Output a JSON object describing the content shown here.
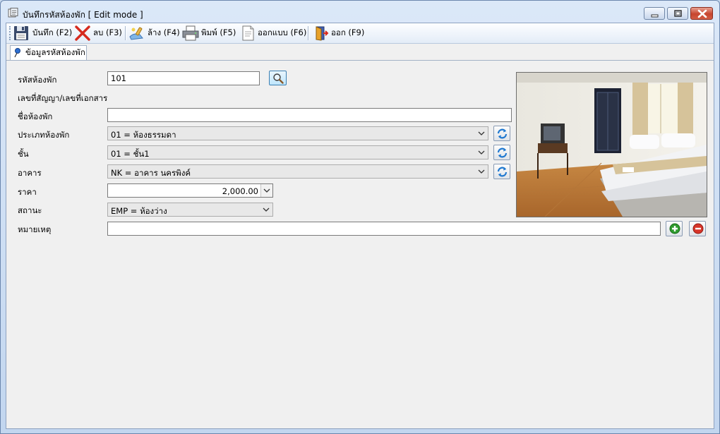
{
  "window": {
    "title": "บันทึกรหัสห้องพัก [ Edit mode ]"
  },
  "toolbar": {
    "save_label": "บันทึก (F2)",
    "delete_label": "ลบ (F3)",
    "clear_label": "ล้าง (F4)",
    "print_label": "พิมพ์ (F5)",
    "design_label": "ออกแบบ (F6)",
    "exit_label": "ออก (F9)"
  },
  "tabs": [
    {
      "label": "ข้อมูลรหัสห้องพัก",
      "active": true
    }
  ],
  "form": {
    "room_code": {
      "label": "รหัสห้องพัก",
      "value": "101"
    },
    "contract_no": {
      "label": "เลขที่สัญญา/เลขที่เอกสาร"
    },
    "room_name": {
      "label": "ชื่อห้องพัก",
      "value": ""
    },
    "room_type": {
      "label": "ประเภทห้องพัก",
      "value": "01 = ห้องธรรมดา"
    },
    "floor": {
      "label": "ชั้น",
      "value": "01 = ชั้น1"
    },
    "building": {
      "label": "อาคาร",
      "value": "NK = อาคาร นครพิงค์"
    },
    "price": {
      "label": "ราคา",
      "value": "2,000.00"
    },
    "status": {
      "label": "สถานะ",
      "value": "EMP = ห้องว่าง"
    },
    "remark": {
      "label": "หมายเหตุ",
      "value": ""
    }
  },
  "colors": {
    "accent": "#3c7fb1",
    "add_green": "#2e9b2e",
    "remove_red": "#d7352a"
  }
}
